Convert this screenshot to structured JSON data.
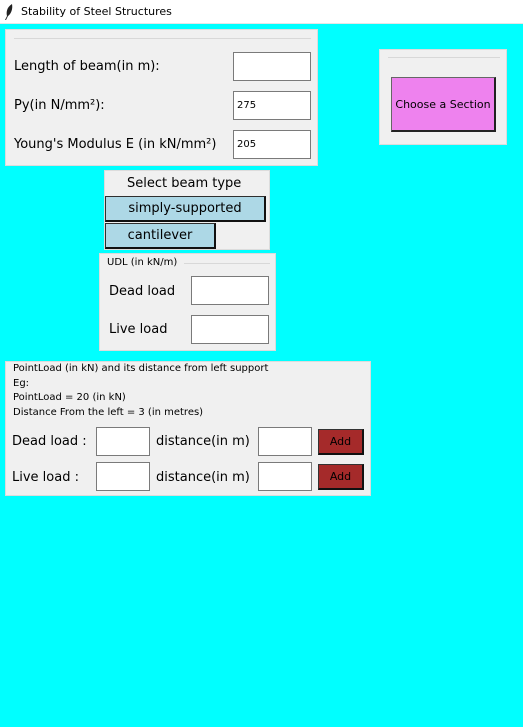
{
  "window": {
    "title": "Stability of Steel Structures",
    "icon": "feather-icon"
  },
  "beam_inputs": {
    "length_label": "Length of beam(in m):",
    "length_value": "",
    "py_label": "Py(in N/mm²):",
    "py_value": "275",
    "youngs_label": "Young's Modulus E (in kN/mm²)",
    "youngs_value": "205"
  },
  "section": {
    "button_label": "Choose a Section",
    "button_color": "#ee82ee"
  },
  "beam_type": {
    "heading": "Select beam type",
    "options": [
      "simply-supported",
      "cantilever"
    ],
    "button_color": "#add8e6"
  },
  "udl": {
    "heading": "UDL (in kN/m)",
    "dead_label": "Dead load",
    "dead_value": "",
    "live_label": "Live load",
    "live_value": ""
  },
  "point_load": {
    "heading": "PointLoad (in kN) and its distance from left support",
    "example_title": "Eg:",
    "example_load": "PointLoad = 20 (in kN)",
    "example_distance": "Distance From the left = 3 (in metres)",
    "dead_label": "Dead load :",
    "live_label": "Live load :",
    "distance_label": "distance(in m)",
    "add_label": "Add",
    "dead_load_value": "",
    "dead_distance_value": "",
    "live_load_value": "",
    "live_distance_value": "",
    "add_color": "#a52a2a"
  },
  "colors": {
    "background": "#00ffff",
    "panel": "#f0f0f0"
  }
}
